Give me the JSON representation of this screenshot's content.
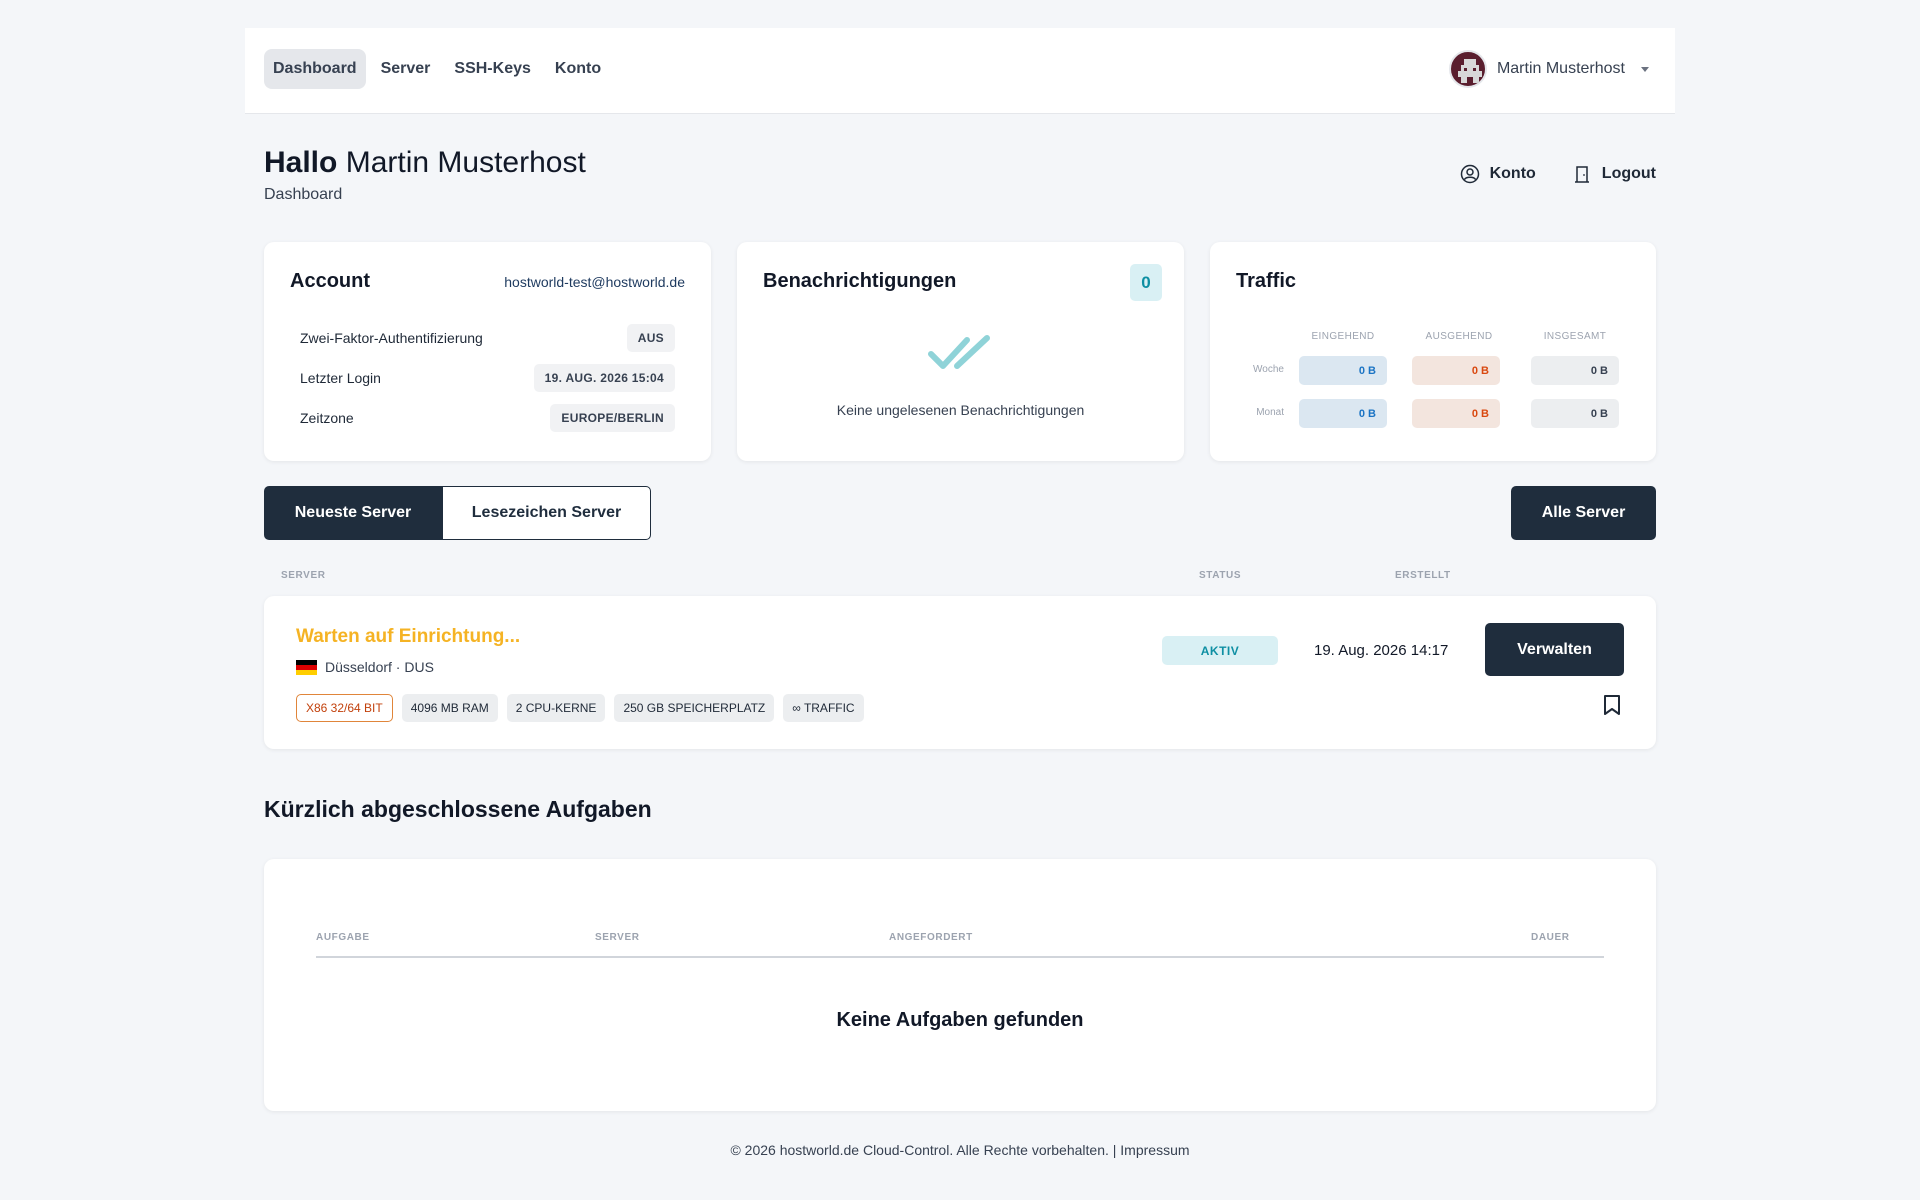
{
  "nav": {
    "items": [
      {
        "label": "Dashboard",
        "active": true
      },
      {
        "label": "Server",
        "active": false
      },
      {
        "label": "SSH-Keys",
        "active": false
      },
      {
        "label": "Konto",
        "active": false
      }
    ],
    "user_name": "Martin Musterhost"
  },
  "header": {
    "greeting_bold": "Hallo",
    "greeting_name": "Martin Musterhost",
    "subtitle": "Dashboard",
    "konto_label": "Konto",
    "logout_label": "Logout"
  },
  "account": {
    "title": "Account",
    "email": "hostworld-test@hostworld.de",
    "rows": [
      {
        "label": "Zwei-Faktor-Authentifizierung",
        "value": "AUS"
      },
      {
        "label": "Letzter Login",
        "value": "19. AUG. 2026 15:04"
      },
      {
        "label": "Zeitzone",
        "value": "EUROPE/BERLIN"
      }
    ]
  },
  "notifications": {
    "title": "Benachrichtigungen",
    "count": "0",
    "empty_text": "Keine ungelesenen Benachrichtigungen"
  },
  "traffic": {
    "title": "Traffic",
    "columns": [
      "EINGEHEND",
      "AUSGEHEND",
      "INSGESAMT"
    ],
    "rows": [
      {
        "label": "Woche",
        "in": "0 B",
        "out": "0 B",
        "total": "0 B"
      },
      {
        "label": "Monat",
        "in": "0 B",
        "out": "0 B",
        "total": "0 B"
      }
    ]
  },
  "servers": {
    "tab_newest": "Neueste Server",
    "tab_bookmarks": "Lesezeichen Server",
    "all_button": "Alle Server",
    "col_server": "SERVER",
    "col_status": "STATUS",
    "col_created": "ERSTELLT",
    "items": [
      {
        "name": "Warten auf Einrichtung...",
        "location": "Düsseldorf · DUS",
        "specs": [
          "X86 32/64 BIT",
          "4096 MB RAM",
          "2 CPU-KERNE",
          "250 GB SPEICHERPLATZ",
          "∞ TRAFFIC"
        ],
        "status": "AKTIV",
        "created": "19. Aug. 2026 14:17",
        "manage_label": "Verwalten"
      }
    ]
  },
  "tasks": {
    "title": "Kürzlich abgeschlossene Aufgaben",
    "col_task": "AUFGABE",
    "col_server": "SERVER",
    "col_requested": "ANGEFORDERT",
    "col_duration": "DAUER",
    "empty_text": "Keine Aufgaben gefunden"
  },
  "footer": {
    "text": "© 2026 hostworld.de Cloud-Control. Alle Rechte vorbehalten. |",
    "link": "Impressum"
  },
  "colors": {
    "primary_dark": "#1f2d3d",
    "server_pending": "#f5b324",
    "status_active": "#0e8fa3"
  }
}
